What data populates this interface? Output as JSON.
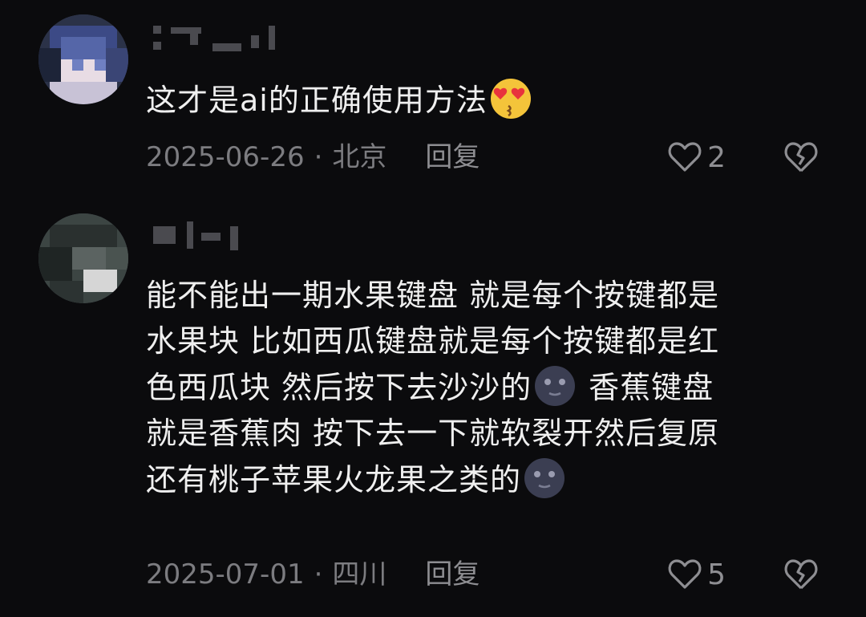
{
  "comments": [
    {
      "content": "这才是ai的正确使用方法",
      "emoji": "heart-eyes-kiss-icon",
      "date": "2025-06-26",
      "separator": "·",
      "location": "北京",
      "reply_label": "回复",
      "likes": "2"
    },
    {
      "content_parts": [
        "能不能出一期水果键盘 就是每个按键都是\n水果块 比如西瓜键盘就是每个按键都是红\n色西瓜块 然后按下去沙沙的",
        " 香蕉键盘\n就是香蕉肉 按下去一下就软裂开然后复原\n还有桃子苹果火龙果之类的"
      ],
      "emoji": "moon-face-icon",
      "date": "2025-07-01",
      "separator": "·",
      "location": "四川",
      "reply_label": "回复",
      "likes": "5"
    }
  ],
  "colors": {
    "background": "#0b0b0d",
    "text": "#efefef",
    "meta": "#7c7c80"
  }
}
